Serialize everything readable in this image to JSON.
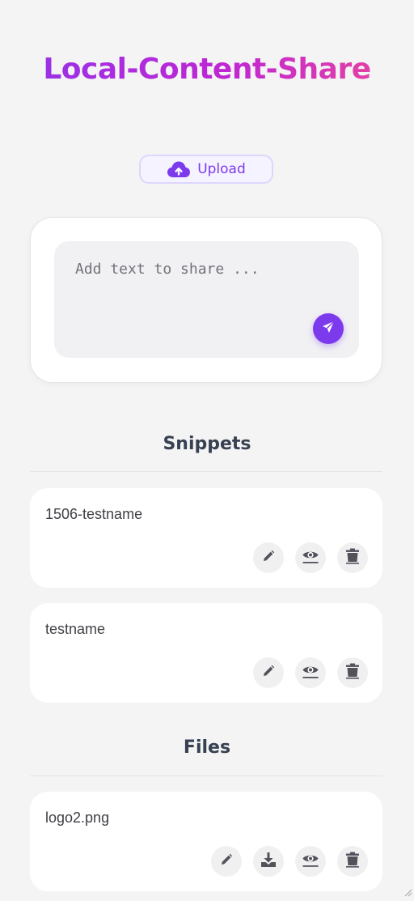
{
  "app": {
    "title": "Local-Content-Share"
  },
  "upload": {
    "label": "Upload"
  },
  "composer": {
    "placeholder": "Add text to share ..."
  },
  "sections": {
    "snippets": {
      "heading": "Snippets",
      "items": [
        {
          "name": "1506-testname"
        },
        {
          "name": "testname"
        }
      ]
    },
    "files": {
      "heading": "Files",
      "items": [
        {
          "name": "logo2.png"
        }
      ]
    }
  },
  "colors": {
    "accent": "#7c3aed",
    "title_gradient": [
      "#9333ea",
      "#c026d3",
      "#ec4899"
    ],
    "background": "#f4f4f5",
    "icon": "#52525b"
  }
}
